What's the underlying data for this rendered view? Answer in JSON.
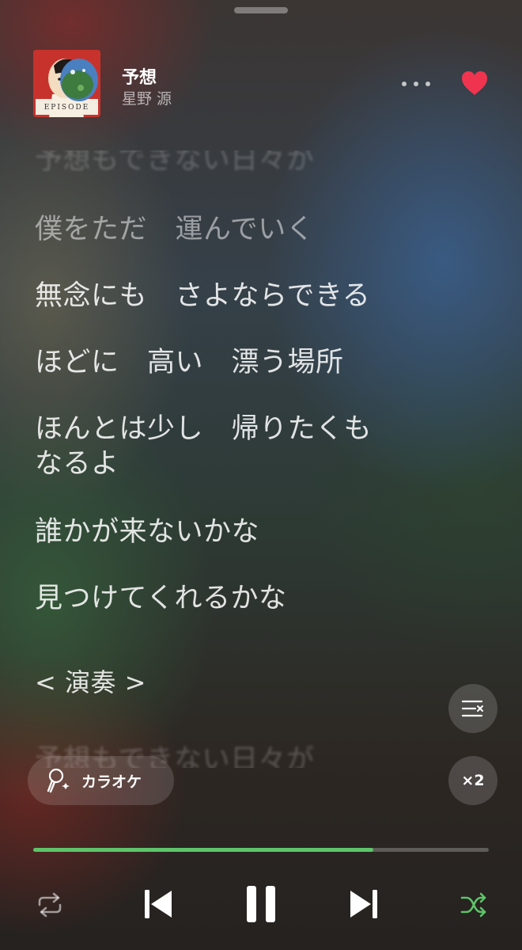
{
  "now_playing": {
    "title": "予想",
    "artist": "星野 源",
    "album_art_text": "EPISODE",
    "liked": true
  },
  "lyrics": [
    {
      "text": "予想もできない日々が",
      "state": "ghost"
    },
    {
      "text": "僕をただ　運んでいく",
      "state": "faded"
    },
    {
      "text": "無念にも　さよならできる",
      "state": "normal"
    },
    {
      "text": "ほどに　高い　漂う場所",
      "state": "normal"
    },
    {
      "text": "ほんとは少し　帰りたくも\nなるよ",
      "state": "normal"
    },
    {
      "text": "誰かが来ないかな",
      "state": "normal"
    },
    {
      "text": "見つけてくれるかな",
      "state": "normal"
    },
    {
      "text": "< 演奏 >",
      "state": "normal"
    },
    {
      "text": "予想もできない日々が",
      "state": "ghost"
    }
  ],
  "controls": {
    "karaoke_label": "カラオケ",
    "speed_label": "×2",
    "progress_fraction": 0.746,
    "shuffle_active": true,
    "repeat_active": false
  },
  "colors": {
    "accent_green": "#5ec46a",
    "heart": "#f0344f"
  },
  "icons": [
    "more-icon",
    "heart-icon",
    "lyrics-menu-icon",
    "microphone-icon",
    "repeat-icon",
    "previous-icon",
    "pause-icon",
    "next-icon",
    "shuffle-icon"
  ]
}
